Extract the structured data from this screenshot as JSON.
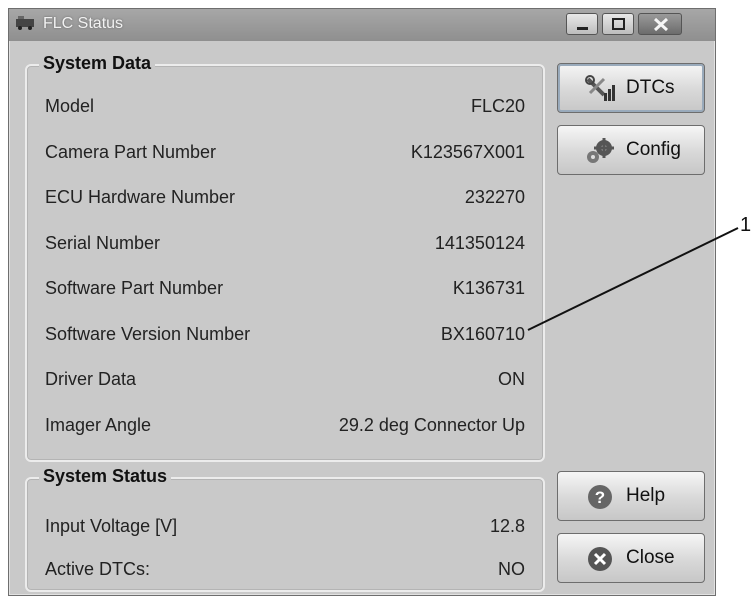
{
  "window": {
    "title": "FLC Status"
  },
  "system_data": {
    "title": "System Data",
    "rows": [
      {
        "label": "Model",
        "value": "FLC20"
      },
      {
        "label": "Camera Part Number",
        "value": "K123567X001"
      },
      {
        "label": "ECU Hardware Number",
        "value": "232270"
      },
      {
        "label": "Serial Number",
        "value": "141350124"
      },
      {
        "label": "Software Part Number",
        "value": "K136731"
      },
      {
        "label": "Software Version Number",
        "value": "BX160710"
      },
      {
        "label": "Driver Data",
        "value": "ON"
      },
      {
        "label": "Imager Angle",
        "value": "29.2 deg Connector Up"
      }
    ]
  },
  "system_status": {
    "title": "System Status",
    "rows": [
      {
        "label": "Input Voltage [V]",
        "value": "12.8"
      },
      {
        "label": "Active DTCs:",
        "value": "NO"
      }
    ]
  },
  "buttons": {
    "dtcs": "DTCs",
    "config": "Config",
    "help": "Help",
    "close": "Close"
  },
  "callout": {
    "number": "1"
  },
  "icons": {
    "app": "truck-icon",
    "dtcs": "tools-icon",
    "config": "gears-icon",
    "help": "question-icon",
    "close": "close-x-icon"
  }
}
